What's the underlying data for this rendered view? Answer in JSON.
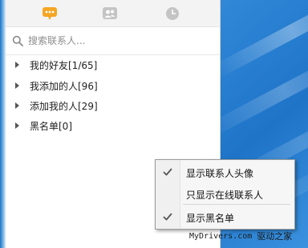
{
  "tabs": [
    {
      "name": "recent-chats",
      "icon": "chat-bubble-icon",
      "active": true,
      "color": "#f5a623"
    },
    {
      "name": "contacts",
      "icon": "contacts-icon",
      "active": false,
      "color": "#bdbdbd"
    },
    {
      "name": "history",
      "icon": "clock-icon",
      "active": false,
      "color": "#bdbdbd"
    }
  ],
  "search": {
    "placeholder": "搜索联系人...",
    "icon": "search-icon"
  },
  "groups": [
    {
      "label": "我的好友[1/65]",
      "icon": "caret-right-icon"
    },
    {
      "label": "我添加的人[96]",
      "icon": "caret-right-icon"
    },
    {
      "label": "添加我的人[29]",
      "icon": "caret-right-icon"
    },
    {
      "label": "黑名单[0]",
      "icon": "caret-right-icon"
    }
  ],
  "context_menu": {
    "items": [
      {
        "label": "显示联系人头像",
        "checked": true
      },
      {
        "label": "只显示在线联系人",
        "checked": false
      },
      {
        "label": "显示黑名单",
        "checked": true
      }
    ]
  },
  "watermark": {
    "site": "MyDrivers.com",
    "name": "驱动之家"
  }
}
